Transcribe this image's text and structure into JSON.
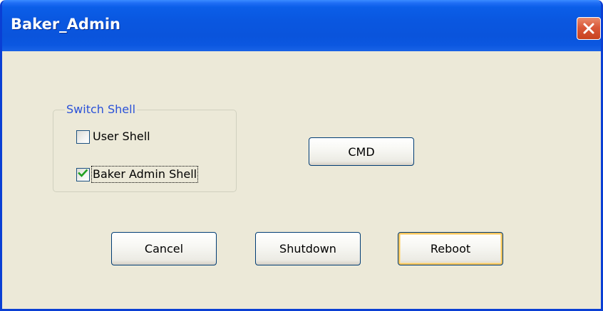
{
  "window": {
    "title": "Baker_Admin"
  },
  "switch_shell": {
    "legend": "Switch Shell",
    "options": [
      {
        "label": "User Shell",
        "checked": false
      },
      {
        "label": "Baker Admin Shell",
        "checked": true
      }
    ]
  },
  "buttons": {
    "cmd": "CMD",
    "cancel": "Cancel",
    "shutdown": "Shutdown",
    "reboot": "Reboot"
  },
  "icons": {
    "close": "close-icon",
    "check": "checkmark-icon"
  },
  "colors": {
    "titlebar": "#0a54dc",
    "window_bg": "#ece9d8",
    "group_legend": "#2a51d8",
    "close_button": "#d9583a",
    "check_mark": "#21a121",
    "default_button_highlight": "#f5c45c"
  }
}
